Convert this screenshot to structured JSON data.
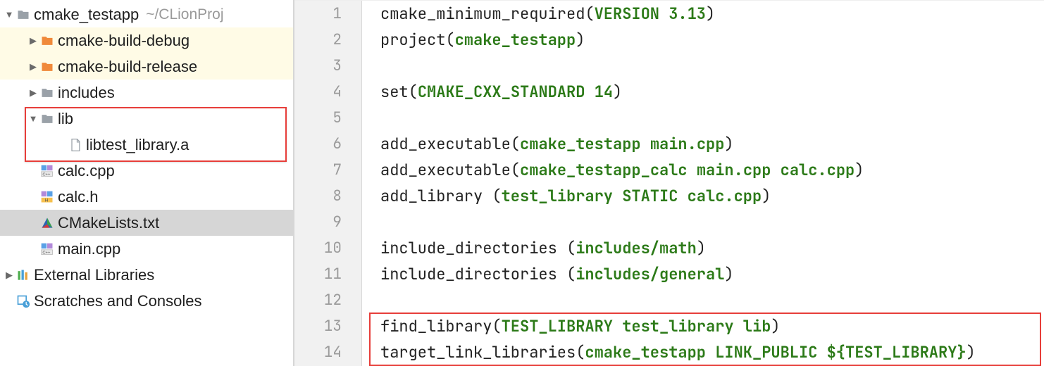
{
  "tree": {
    "root_name": "cmake_testapp",
    "root_path": "~/CLionProj",
    "children": {
      "build_debug": "cmake-build-debug",
      "build_release": "cmake-build-release",
      "includes": "includes",
      "lib": "lib",
      "lib_file": "libtest_library.a",
      "calc_cpp": "calc.cpp",
      "calc_h": "calc.h",
      "cmakelists": "CMakeLists.txt",
      "main_cpp": "main.cpp"
    },
    "ext_lib": "External Libraries",
    "scratches": "Scratches and Consoles"
  },
  "code": {
    "lines": [
      {
        "n": "1",
        "segs": [
          [
            "txt",
            "cmake_minimum_required("
          ],
          [
            "kw",
            "VERSION 3.13"
          ],
          [
            "txt",
            ")"
          ]
        ]
      },
      {
        "n": "2",
        "segs": [
          [
            "txt",
            "project("
          ],
          [
            "kw",
            "cmake_testapp"
          ],
          [
            "txt",
            ")"
          ]
        ]
      },
      {
        "n": "3",
        "segs": []
      },
      {
        "n": "4",
        "segs": [
          [
            "txt",
            "set("
          ],
          [
            "kw",
            "CMAKE_CXX_STANDARD 14"
          ],
          [
            "txt",
            ")"
          ]
        ]
      },
      {
        "n": "5",
        "segs": []
      },
      {
        "n": "6",
        "segs": [
          [
            "txt",
            "add_executable("
          ],
          [
            "kw",
            "cmake_testapp main.cpp"
          ],
          [
            "txt",
            ")"
          ]
        ]
      },
      {
        "n": "7",
        "segs": [
          [
            "txt",
            "add_executable("
          ],
          [
            "kw",
            "cmake_testapp_calc main.cpp calc.cpp"
          ],
          [
            "txt",
            ")"
          ]
        ]
      },
      {
        "n": "8",
        "segs": [
          [
            "txt",
            "add_library ("
          ],
          [
            "kw",
            "test_library STATIC calc.cpp"
          ],
          [
            "txt",
            ")"
          ]
        ]
      },
      {
        "n": "9",
        "segs": []
      },
      {
        "n": "10",
        "segs": [
          [
            "txt",
            "include_directories ("
          ],
          [
            "kw",
            "includes/math"
          ],
          [
            "txt",
            ")"
          ]
        ]
      },
      {
        "n": "11",
        "segs": [
          [
            "txt",
            "include_directories ("
          ],
          [
            "kw",
            "includes/general"
          ],
          [
            "txt",
            ")"
          ]
        ]
      },
      {
        "n": "12",
        "segs": []
      },
      {
        "n": "13",
        "segs": [
          [
            "txt",
            "find_library("
          ],
          [
            "kw",
            "TEST_LIBRARY test_library lib"
          ],
          [
            "txt",
            ")"
          ]
        ]
      },
      {
        "n": "14",
        "segs": [
          [
            "txt",
            "target_link_libraries("
          ],
          [
            "kw",
            "cmake_testapp LINK_PUBLIC "
          ],
          [
            "var",
            "${TEST_LIBRARY}"
          ],
          [
            "txt",
            ")"
          ]
        ]
      }
    ]
  }
}
